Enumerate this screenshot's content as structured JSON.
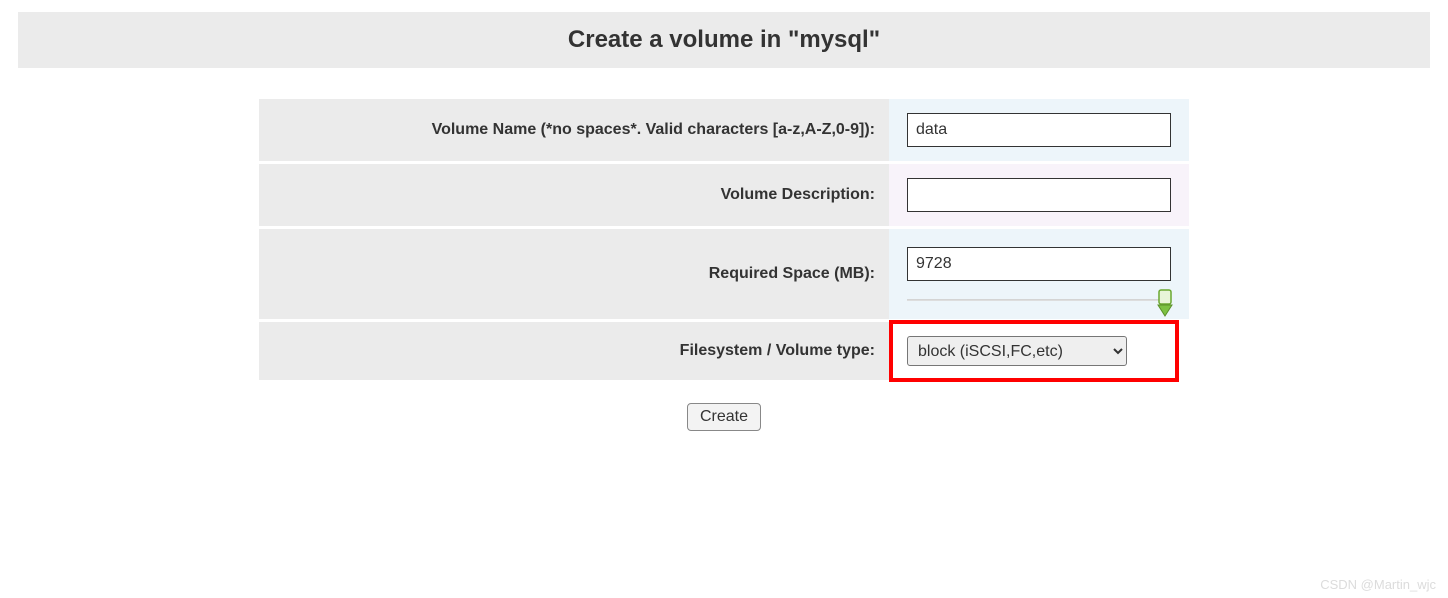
{
  "header": {
    "title": "Create a volume in \"mysql\""
  },
  "form": {
    "volume_name": {
      "label": "Volume Name (*no spaces*. Valid characters [a-z,A-Z,0-9]):",
      "value": "data"
    },
    "volume_description": {
      "label": "Volume Description:",
      "value": ""
    },
    "required_space": {
      "label": "Required Space (MB):",
      "value": "9728"
    },
    "filesystem_type": {
      "label": "Filesystem / Volume type:",
      "selected": "block (iSCSI,FC,etc)"
    },
    "create_button": "Create"
  },
  "watermark": "CSDN @Martin_wjc"
}
